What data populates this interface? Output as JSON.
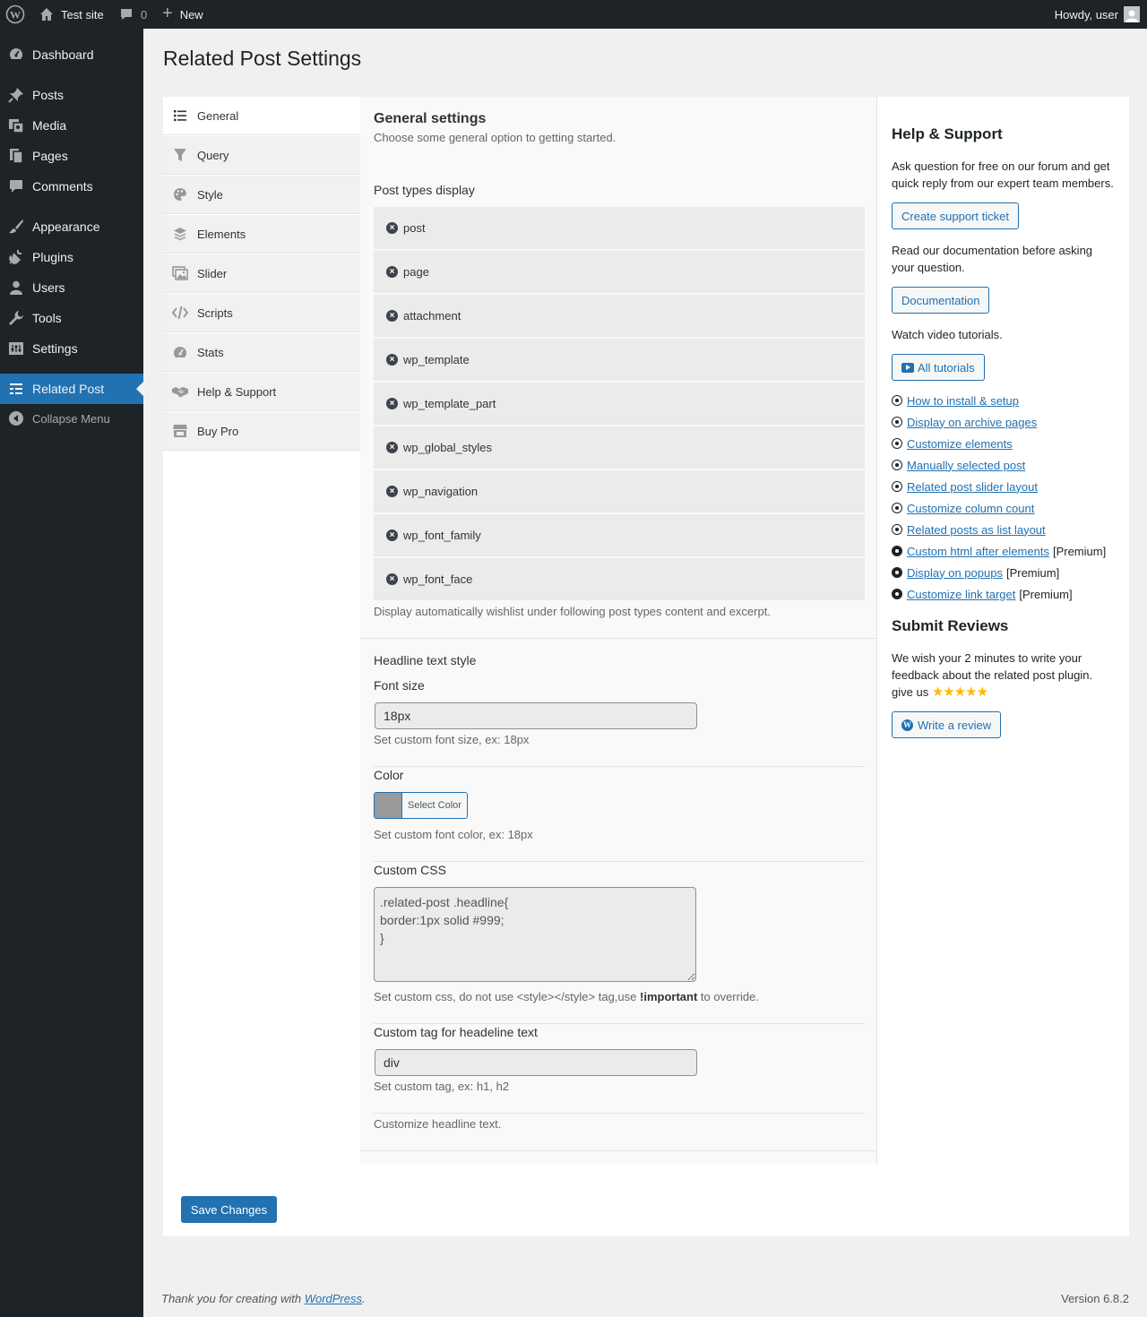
{
  "admin_bar": {
    "site_name": "Test site",
    "comments_count": "0",
    "new_label": "New",
    "howdy": "Howdy, user"
  },
  "sidebar": {
    "items": [
      {
        "label": "Dashboard",
        "icon": "dashboard-icon"
      },
      {
        "label": "Posts",
        "icon": "pin-icon"
      },
      {
        "label": "Media",
        "icon": "media-icon"
      },
      {
        "label": "Pages",
        "icon": "pages-icon"
      },
      {
        "label": "Comments",
        "icon": "comment-icon"
      },
      {
        "label": "Appearance",
        "icon": "brush-icon"
      },
      {
        "label": "Plugins",
        "icon": "plug-icon"
      },
      {
        "label": "Users",
        "icon": "user-icon"
      },
      {
        "label": "Tools",
        "icon": "wrench-icon"
      },
      {
        "label": "Settings",
        "icon": "settings-icon"
      },
      {
        "label": "Related Post",
        "icon": "list-icon"
      }
    ],
    "collapse_label": "Collapse Menu"
  },
  "page": {
    "title": "Related Post Settings"
  },
  "tabs": [
    {
      "label": "General",
      "icon": "list-icon"
    },
    {
      "label": "Query",
      "icon": "filter-icon"
    },
    {
      "label": "Style",
      "icon": "palette-icon"
    },
    {
      "label": "Elements",
      "icon": "layers-icon"
    },
    {
      "label": "Slider",
      "icon": "images-icon"
    },
    {
      "label": "Scripts",
      "icon": "code-icon"
    },
    {
      "label": "Stats",
      "icon": "gauge-icon"
    },
    {
      "label": "Help & Support",
      "icon": "handshake-icon"
    },
    {
      "label": "Buy Pro",
      "icon": "store-icon"
    }
  ],
  "general": {
    "title": "General settings",
    "subtitle": "Choose some general option to getting started.",
    "post_types_label": "Post types display",
    "post_types": [
      "post",
      "page",
      "attachment",
      "wp_template",
      "wp_template_part",
      "wp_global_styles",
      "wp_navigation",
      "wp_font_family",
      "wp_font_face"
    ],
    "post_types_desc": "Display automatically wishlist under following post types content and excerpt.",
    "headline_style_label": "Headline text style",
    "font_size_label": "Font size",
    "font_size_value": "18px",
    "font_size_desc": "Set custom font size, ex: 18px",
    "color_label": "Color",
    "color_button": "Select Color",
    "color_value": "#999999",
    "color_desc": "Set custom font color, ex: 18px",
    "custom_css_label": "Custom CSS",
    "custom_css_value": ".related-post .headline{\nborder:1px solid #999;\n}",
    "custom_css_desc_pre": "Set custom css, do not use <style></style> tag,use ",
    "custom_css_desc_strong": "!important",
    "custom_css_desc_post": " to override.",
    "custom_tag_label": "Custom tag for headeline text",
    "custom_tag_value": "div",
    "custom_tag_desc": "Set custom tag, ex: h1, h2",
    "customize_headline_desc": "Customize headline text."
  },
  "help": {
    "title": "Help & Support",
    "forum_text": "Ask question for free on our forum and get quick reply from our expert team members.",
    "ticket_button": "Create support ticket",
    "doc_text": "Read our documentation before asking your question.",
    "doc_button": "Documentation",
    "video_text": "Watch video tutorials.",
    "tutorials_button": "All tutorials",
    "tutorials": [
      {
        "label": "How to install & setup",
        "premium": ""
      },
      {
        "label": "Display on archive pages",
        "premium": ""
      },
      {
        "label": "Customize elements",
        "premium": ""
      },
      {
        "label": "Manually selected post",
        "premium": ""
      },
      {
        "label": "Related post slider layout",
        "premium": ""
      },
      {
        "label": "Customize column count",
        "premium": ""
      },
      {
        "label": "Related posts as list layout",
        "premium": ""
      },
      {
        "label": "Custom html after elements",
        "premium": "[Premium]"
      },
      {
        "label": "Display on popups",
        "premium": "[Premium]"
      },
      {
        "label": "Customize link target",
        "premium": "[Premium]"
      }
    ],
    "reviews_title": "Submit Reviews",
    "reviews_text": "We wish your 2 minutes to write your feedback about the related post plugin.",
    "give_us": "give us",
    "stars": "★★★★★",
    "review_button": "Write a review"
  },
  "save_button": "Save Changes",
  "footer": {
    "thanks_pre": "Thank you for creating with ",
    "thanks_link": "WordPress",
    "thanks_post": ".",
    "version": "Version 6.8.2"
  }
}
